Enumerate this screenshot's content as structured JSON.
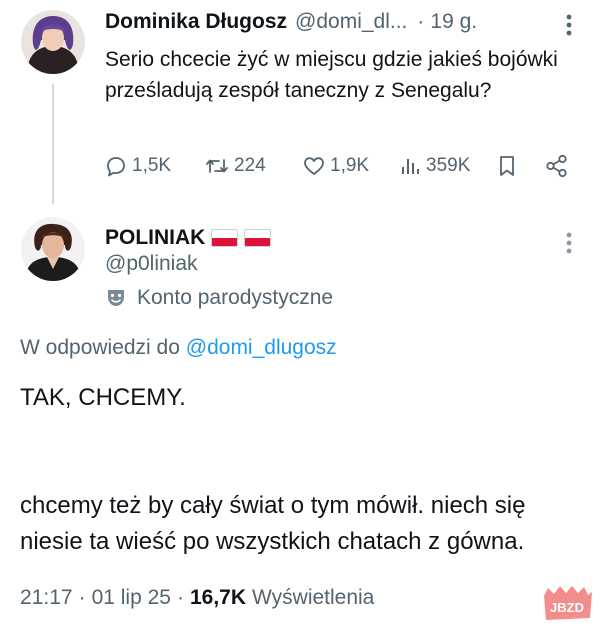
{
  "parent_tweet": {
    "name": "Dominika Długosz",
    "handle": "@domi_dl...",
    "dot": "·",
    "time": "19 g.",
    "text": "Serio chcecie żyć w miejscu gdzie jakieś bojówki prześladują zespół taneczny z Senegalu?",
    "replies": "1,5K",
    "retweets": "224",
    "likes": "1,9K",
    "views": "359K"
  },
  "reply_tweet": {
    "name": "POLINIAK",
    "flag_icon": "poland-flag-icon",
    "handle": "@p0liniak",
    "parody_label": "Konto parodystyczne",
    "reply_prefix": "W odpowiedzi do",
    "reply_to": "@domi_dlugosz",
    "text_line_1": "TAK, CHCEMY.",
    "text_line_2": "chcemy też by cały świat o tym mówił. niech się niesie ta wieść po wszystkich chatach z gówna.",
    "time": "21:17",
    "date": "01 lip 25",
    "views_count": "16,7K",
    "views_label": "Wyświetlenia",
    "sep": "·"
  },
  "watermark": {
    "text": "JBZD",
    "color": "#e8302d"
  },
  "colors": {
    "text": "#0f1419",
    "secondary": "#536471",
    "link": "#1d9bf0",
    "thread_line": "#cfd9de"
  }
}
